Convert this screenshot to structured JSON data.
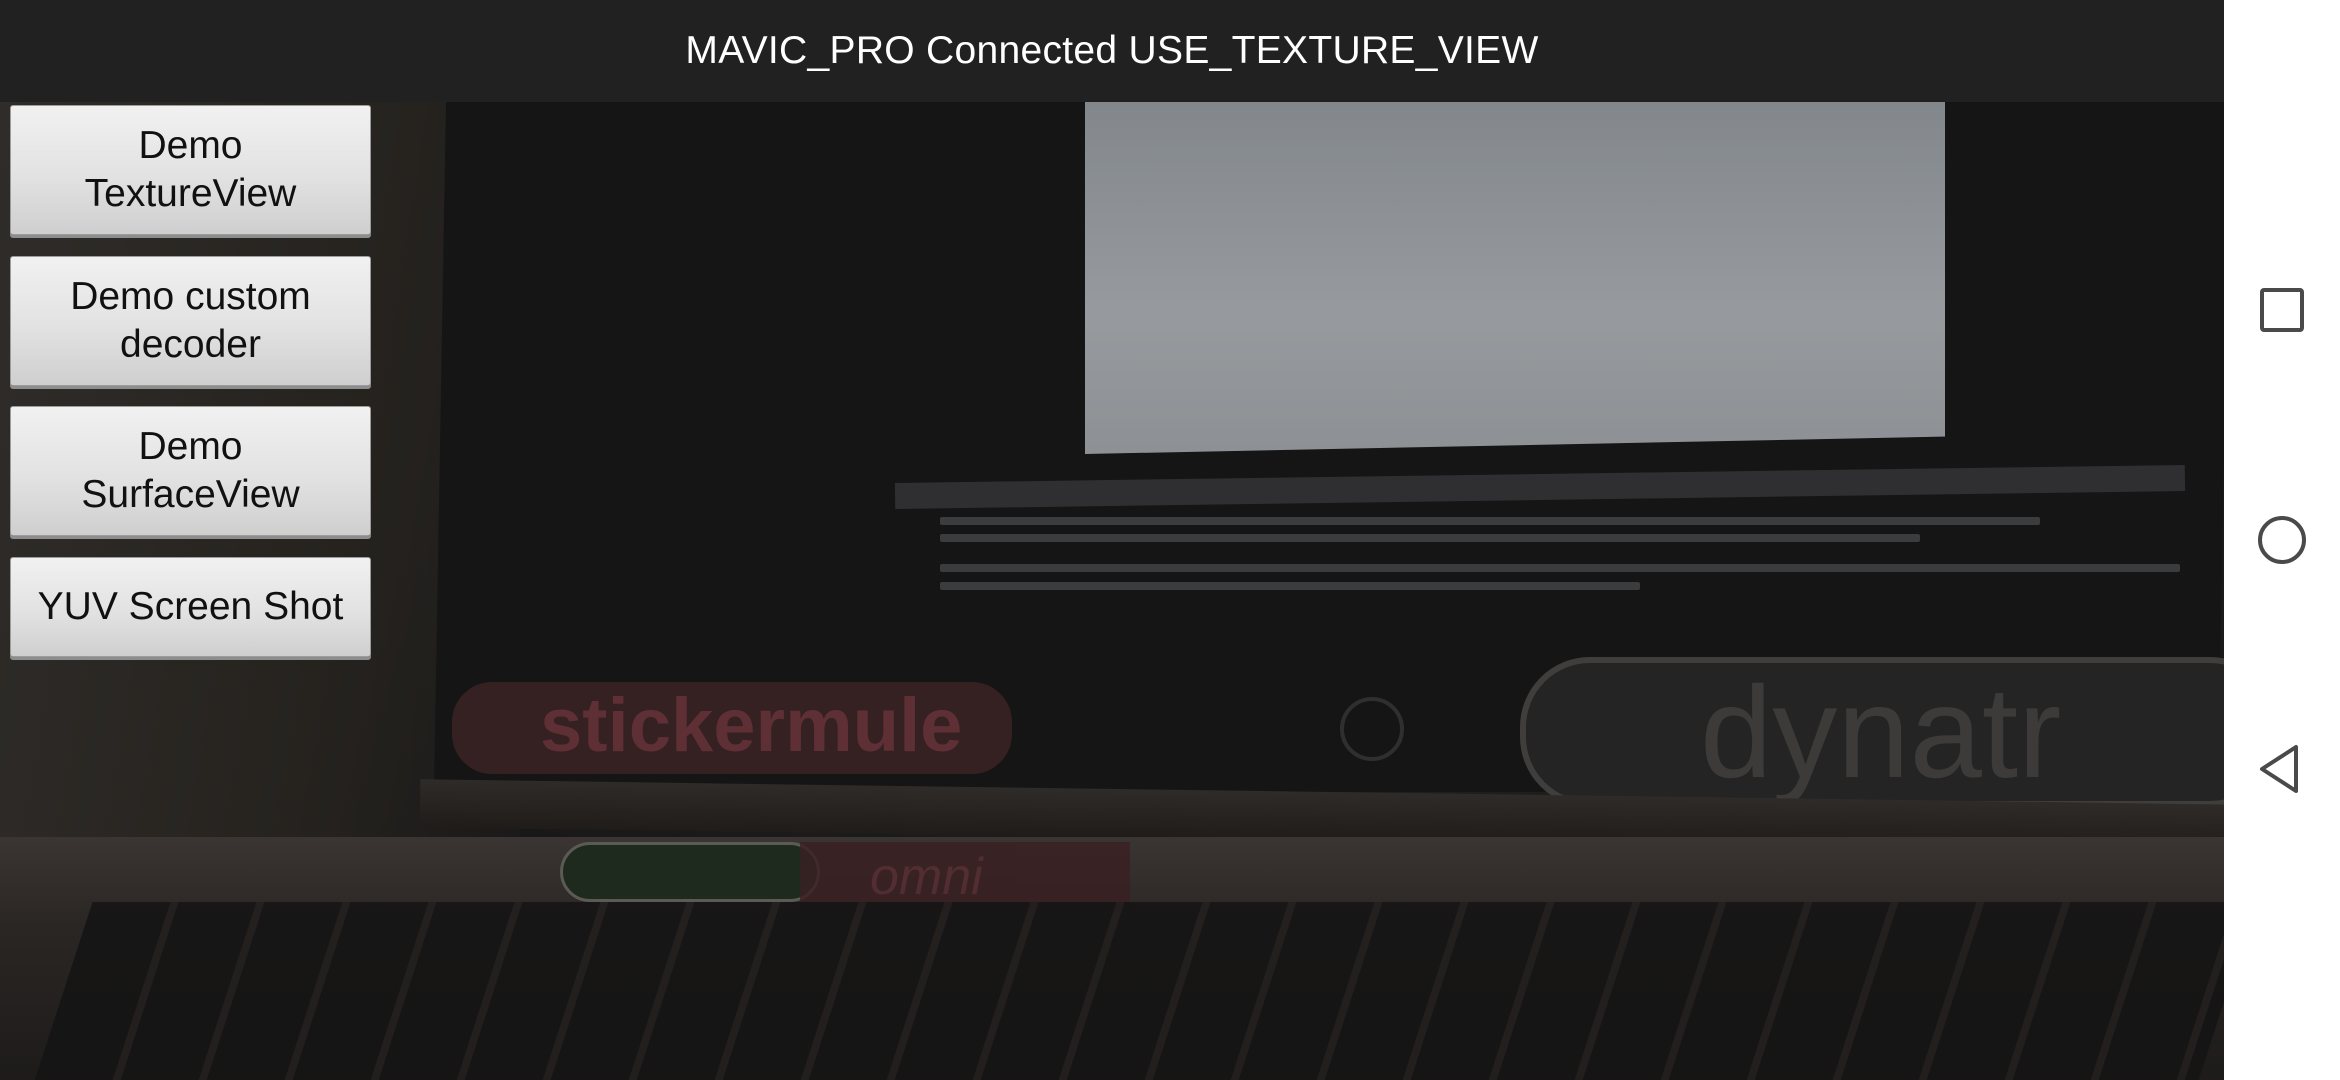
{
  "title_bar": {
    "text": "MAVIC_PRO Connected USE_TEXTURE_VIEW"
  },
  "buttons": {
    "demo_textureview": "Demo\nTextureView",
    "demo_custom_decoder": "Demo custom\ndecoder",
    "demo_surfaceview": "Demo\nSurfaceView",
    "yuv_screen_shot": "YUV Screen Shot"
  },
  "video_feed": {
    "sticker_left": "stickermule",
    "sticker_right": "dynatr",
    "sticker_deck": "omni"
  },
  "navigation_bar": {
    "icons": [
      "recents-icon",
      "home-icon",
      "back-icon"
    ]
  },
  "colors": {
    "title_bar_bg": "#212121",
    "title_text": "#ffffff",
    "button_bg": "#e2e2e2",
    "button_text": "#111111",
    "nav_bar_bg": "#ffffff",
    "nav_icon": "#4a4a4a"
  }
}
